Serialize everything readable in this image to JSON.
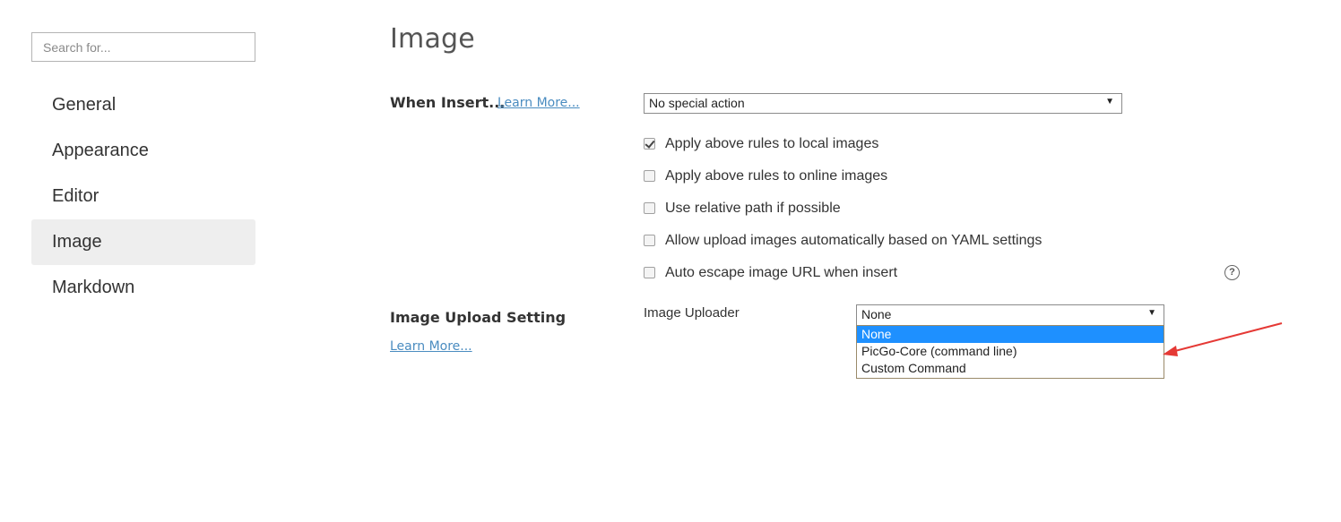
{
  "sidebar": {
    "search_placeholder": "Search for...",
    "items": [
      {
        "label": "General"
      },
      {
        "label": "Appearance"
      },
      {
        "label": "Editor"
      },
      {
        "label": "Image",
        "active": true
      },
      {
        "label": "Markdown"
      }
    ]
  },
  "main": {
    "title": "Image",
    "when_insert": {
      "label": "When Insert...",
      "learn_more": "Learn More...",
      "select_value": "No special action"
    },
    "checkboxes": [
      {
        "label": "Apply above rules to local images",
        "checked": true
      },
      {
        "label": "Apply above rules to online images",
        "checked": false
      },
      {
        "label": "Use relative path if possible",
        "checked": false
      },
      {
        "label": "Allow upload images automatically based on YAML settings",
        "checked": false
      },
      {
        "label": "Auto escape image URL when insert",
        "checked": false
      }
    ],
    "help_icon": "question-circle-icon",
    "upload": {
      "label": "Image Upload Setting",
      "learn_more": "Learn More...",
      "uploader_label": "Image Uploader",
      "select_value": "None",
      "options": [
        "None",
        "PicGo-Core (command line)",
        "Custom Command"
      ],
      "selected_index": 0
    }
  },
  "colors": {
    "accent_selected": "#1e90ff",
    "link": "#4a8cc0",
    "annotation_arrow": "#e53935",
    "active_nav_bg": "#eeeeee"
  }
}
